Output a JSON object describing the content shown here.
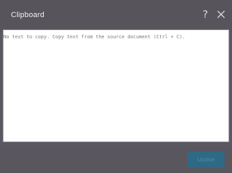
{
  "dialog": {
    "title": "Clipboard",
    "help_label": "?",
    "close_icon": "close-icon"
  },
  "clipboard": {
    "text": "No text to copy. Copy text from the source document (Ctrl + C)."
  },
  "footer": {
    "update_label": "Update"
  },
  "colors": {
    "titlebar": "#57545c",
    "textarea_bg": "#ffffff",
    "button_bg": "#2e6a86"
  }
}
